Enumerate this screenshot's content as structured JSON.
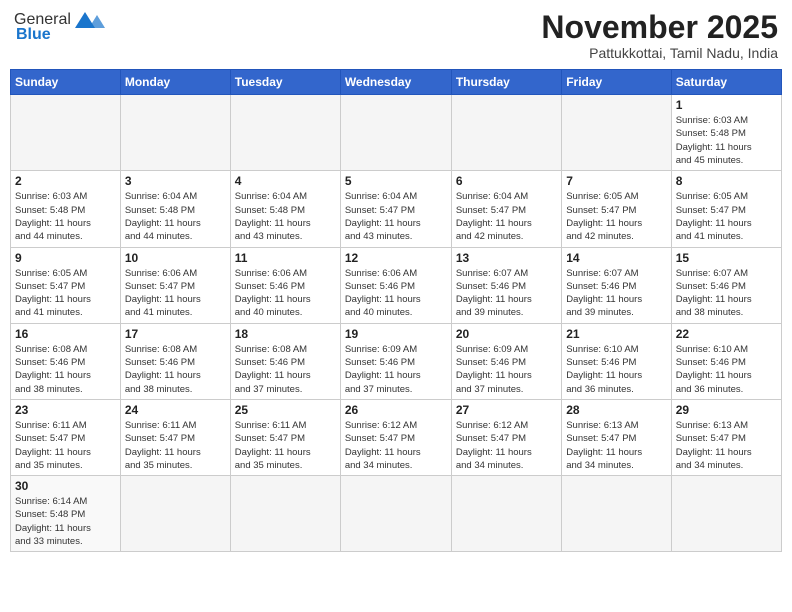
{
  "header": {
    "logo_general": "General",
    "logo_blue": "Blue",
    "month_title": "November 2025",
    "subtitle": "Pattukkottai, Tamil Nadu, India"
  },
  "days_of_week": [
    "Sunday",
    "Monday",
    "Tuesday",
    "Wednesday",
    "Thursday",
    "Friday",
    "Saturday"
  ],
  "weeks": [
    [
      {
        "day": "",
        "info": ""
      },
      {
        "day": "",
        "info": ""
      },
      {
        "day": "",
        "info": ""
      },
      {
        "day": "",
        "info": ""
      },
      {
        "day": "",
        "info": ""
      },
      {
        "day": "",
        "info": ""
      },
      {
        "day": "1",
        "info": "Sunrise: 6:03 AM\nSunset: 5:48 PM\nDaylight: 11 hours\nand 45 minutes."
      }
    ],
    [
      {
        "day": "2",
        "info": "Sunrise: 6:03 AM\nSunset: 5:48 PM\nDaylight: 11 hours\nand 44 minutes."
      },
      {
        "day": "3",
        "info": "Sunrise: 6:04 AM\nSunset: 5:48 PM\nDaylight: 11 hours\nand 44 minutes."
      },
      {
        "day": "4",
        "info": "Sunrise: 6:04 AM\nSunset: 5:48 PM\nDaylight: 11 hours\nand 43 minutes."
      },
      {
        "day": "5",
        "info": "Sunrise: 6:04 AM\nSunset: 5:47 PM\nDaylight: 11 hours\nand 43 minutes."
      },
      {
        "day": "6",
        "info": "Sunrise: 6:04 AM\nSunset: 5:47 PM\nDaylight: 11 hours\nand 42 minutes."
      },
      {
        "day": "7",
        "info": "Sunrise: 6:05 AM\nSunset: 5:47 PM\nDaylight: 11 hours\nand 42 minutes."
      },
      {
        "day": "8",
        "info": "Sunrise: 6:05 AM\nSunset: 5:47 PM\nDaylight: 11 hours\nand 41 minutes."
      }
    ],
    [
      {
        "day": "9",
        "info": "Sunrise: 6:05 AM\nSunset: 5:47 PM\nDaylight: 11 hours\nand 41 minutes."
      },
      {
        "day": "10",
        "info": "Sunrise: 6:06 AM\nSunset: 5:47 PM\nDaylight: 11 hours\nand 41 minutes."
      },
      {
        "day": "11",
        "info": "Sunrise: 6:06 AM\nSunset: 5:46 PM\nDaylight: 11 hours\nand 40 minutes."
      },
      {
        "day": "12",
        "info": "Sunrise: 6:06 AM\nSunset: 5:46 PM\nDaylight: 11 hours\nand 40 minutes."
      },
      {
        "day": "13",
        "info": "Sunrise: 6:07 AM\nSunset: 5:46 PM\nDaylight: 11 hours\nand 39 minutes."
      },
      {
        "day": "14",
        "info": "Sunrise: 6:07 AM\nSunset: 5:46 PM\nDaylight: 11 hours\nand 39 minutes."
      },
      {
        "day": "15",
        "info": "Sunrise: 6:07 AM\nSunset: 5:46 PM\nDaylight: 11 hours\nand 38 minutes."
      }
    ],
    [
      {
        "day": "16",
        "info": "Sunrise: 6:08 AM\nSunset: 5:46 PM\nDaylight: 11 hours\nand 38 minutes."
      },
      {
        "day": "17",
        "info": "Sunrise: 6:08 AM\nSunset: 5:46 PM\nDaylight: 11 hours\nand 38 minutes."
      },
      {
        "day": "18",
        "info": "Sunrise: 6:08 AM\nSunset: 5:46 PM\nDaylight: 11 hours\nand 37 minutes."
      },
      {
        "day": "19",
        "info": "Sunrise: 6:09 AM\nSunset: 5:46 PM\nDaylight: 11 hours\nand 37 minutes."
      },
      {
        "day": "20",
        "info": "Sunrise: 6:09 AM\nSunset: 5:46 PM\nDaylight: 11 hours\nand 37 minutes."
      },
      {
        "day": "21",
        "info": "Sunrise: 6:10 AM\nSunset: 5:46 PM\nDaylight: 11 hours\nand 36 minutes."
      },
      {
        "day": "22",
        "info": "Sunrise: 6:10 AM\nSunset: 5:46 PM\nDaylight: 11 hours\nand 36 minutes."
      }
    ],
    [
      {
        "day": "23",
        "info": "Sunrise: 6:11 AM\nSunset: 5:47 PM\nDaylight: 11 hours\nand 35 minutes."
      },
      {
        "day": "24",
        "info": "Sunrise: 6:11 AM\nSunset: 5:47 PM\nDaylight: 11 hours\nand 35 minutes."
      },
      {
        "day": "25",
        "info": "Sunrise: 6:11 AM\nSunset: 5:47 PM\nDaylight: 11 hours\nand 35 minutes."
      },
      {
        "day": "26",
        "info": "Sunrise: 6:12 AM\nSunset: 5:47 PM\nDaylight: 11 hours\nand 34 minutes."
      },
      {
        "day": "27",
        "info": "Sunrise: 6:12 AM\nSunset: 5:47 PM\nDaylight: 11 hours\nand 34 minutes."
      },
      {
        "day": "28",
        "info": "Sunrise: 6:13 AM\nSunset: 5:47 PM\nDaylight: 11 hours\nand 34 minutes."
      },
      {
        "day": "29",
        "info": "Sunrise: 6:13 AM\nSunset: 5:47 PM\nDaylight: 11 hours\nand 34 minutes."
      }
    ],
    [
      {
        "day": "30",
        "info": "Sunrise: 6:14 AM\nSunset: 5:48 PM\nDaylight: 11 hours\nand 33 minutes."
      },
      {
        "day": "",
        "info": ""
      },
      {
        "day": "",
        "info": ""
      },
      {
        "day": "",
        "info": ""
      },
      {
        "day": "",
        "info": ""
      },
      {
        "day": "",
        "info": ""
      },
      {
        "day": "",
        "info": ""
      }
    ]
  ]
}
